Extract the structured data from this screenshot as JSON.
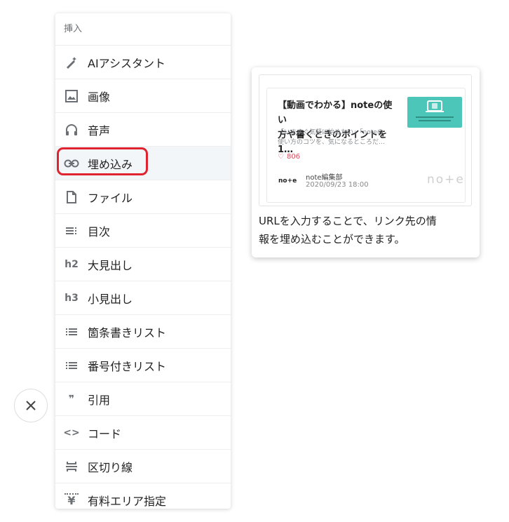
{
  "menu": {
    "header": "挿入",
    "items": [
      {
        "label": "AIアシスタント",
        "icon": "magic-wand-icon"
      },
      {
        "label": "画像",
        "icon": "image-icon"
      },
      {
        "label": "音声",
        "icon": "headphones-icon"
      },
      {
        "label": "埋め込み",
        "icon": "link-icon"
      },
      {
        "label": "ファイル",
        "icon": "file-icon"
      },
      {
        "label": "目次",
        "icon": "toc-icon"
      },
      {
        "label": "大見出し",
        "icon": "h2-icon",
        "glyph": "h2"
      },
      {
        "label": "小見出し",
        "icon": "h3-icon",
        "glyph": "h3"
      },
      {
        "label": "箇条書きリスト",
        "icon": "bullet-list-icon"
      },
      {
        "label": "番号付きリスト",
        "icon": "numbered-list-icon"
      },
      {
        "label": "引用",
        "icon": "quote-icon",
        "glyph": "❞"
      },
      {
        "label": "コード",
        "icon": "code-icon",
        "glyph": "<>"
      },
      {
        "label": "区切り線",
        "icon": "divider-icon"
      },
      {
        "label": "有料エリア指定",
        "icon": "paid-area-icon",
        "glyph": "¥"
      }
    ]
  },
  "tooltip": {
    "card": {
      "title": "【動画でわかる】noteの使い\n方や書くときのポイントを1…",
      "description": "「いますぐ気軽に始めたい」「noteの\n使い方のコツを、気になるところだ…",
      "likes": "806",
      "logo": "no+e",
      "author": "note編集部",
      "date": "2020/09/23 18:00",
      "brand": "no+e"
    },
    "description": "URLを入力することで、リンク先の情\n報を埋め込むことができます。"
  },
  "colors": {
    "highlight": "#e0232f",
    "accent": "#4bc6b9",
    "like": "#e0475a"
  }
}
